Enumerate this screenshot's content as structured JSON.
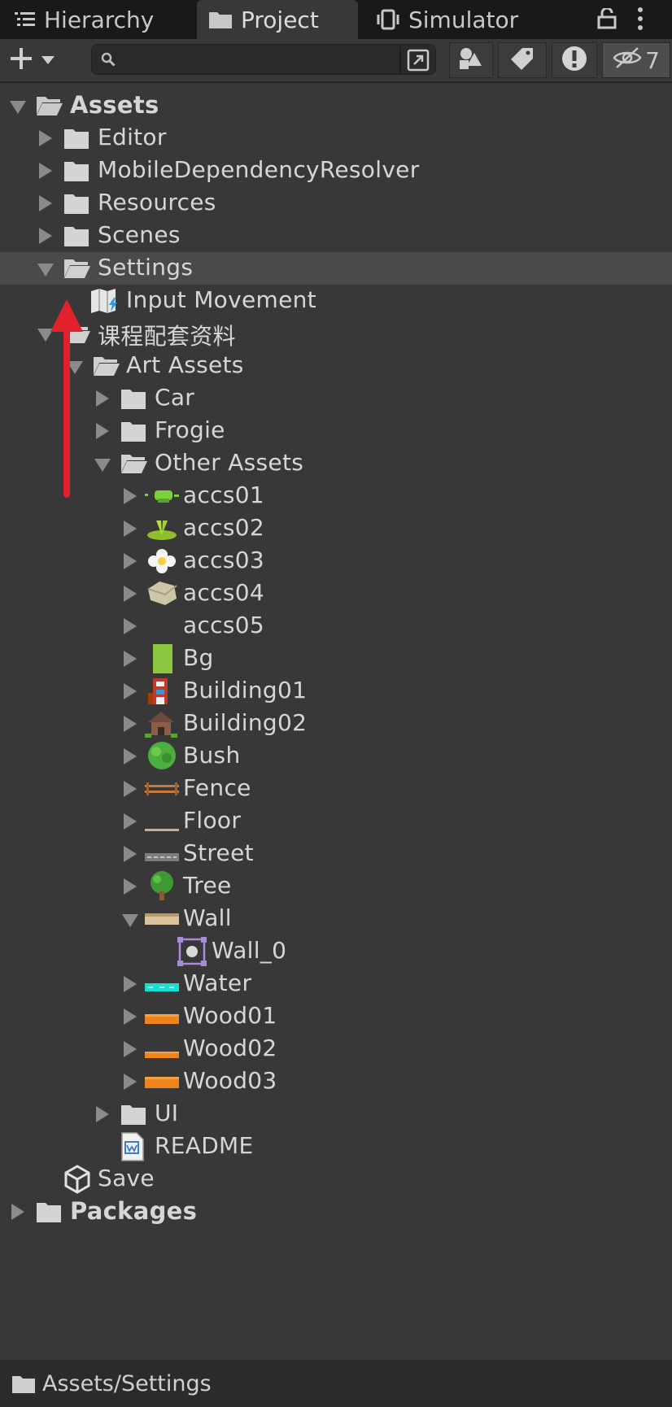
{
  "tabs": [
    {
      "label": "Hierarchy",
      "icon": "list-icon"
    },
    {
      "label": "Project",
      "icon": "folder-icon",
      "active": true
    },
    {
      "label": "Simulator",
      "icon": "phone-icon"
    }
  ],
  "toolbar": {
    "add_label": "+",
    "search_value": "",
    "hidden_count": "7"
  },
  "tree": {
    "assets": "Assets",
    "editor": "Editor",
    "mobile": "MobileDependencyResolver",
    "resources": "Resources",
    "scenes": "Scenes",
    "settings": "Settings",
    "input_movement": "Input Movement",
    "course": "课程配套资料",
    "art_assets": "Art Assets",
    "car": "Car",
    "frogie": "Frogie",
    "other_assets": "Other Assets",
    "accs01": "accs01",
    "accs02": "accs02",
    "accs03": "accs03",
    "accs04": "accs04",
    "accs05": "accs05",
    "bg": "Bg",
    "building01": "Building01",
    "building02": "Building02",
    "bush": "Bush",
    "fence": "Fence",
    "floor": "Floor",
    "street": "Street",
    "tree": "Tree",
    "wall": "Wall",
    "wall_0": "Wall_0",
    "water": "Water",
    "wood01": "Wood01",
    "wood02": "Wood02",
    "wood03": "Wood03",
    "ui": "UI",
    "readme": "README",
    "save": "Save",
    "packages": "Packages"
  },
  "footer": {
    "path": "Assets/Settings"
  },
  "colors": {
    "background": "#383838",
    "tabbar": "#191919",
    "selected_row": "#4a4a4a",
    "annotation_arrow": "#e0202a"
  }
}
